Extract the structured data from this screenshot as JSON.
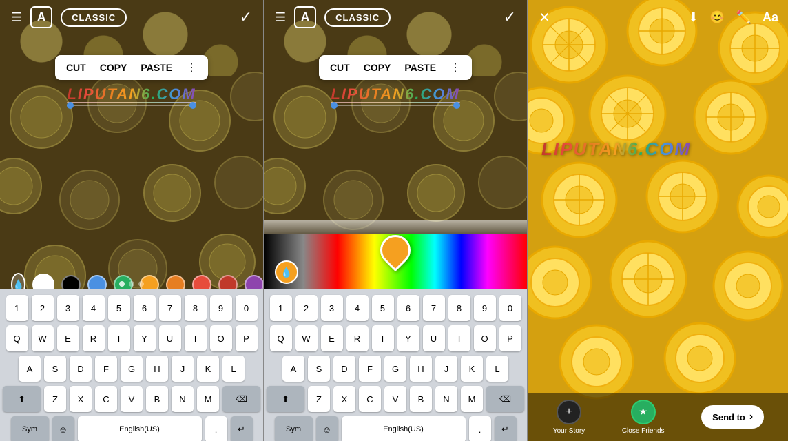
{
  "panels": [
    {
      "id": "panel1",
      "topbar": {
        "hamburger": "☰",
        "textFormat": "A",
        "mode": "CLASSIC",
        "checkmark": "✓"
      },
      "editMenu": {
        "cut": "CUT",
        "copy": "COPY",
        "paste": "PASTE",
        "dots": "⋮"
      },
      "watermark": "LIPUTAN6.COM",
      "colors": [
        "#ffffff",
        "#000000",
        "#4a90e2",
        "#27ae60",
        "#f5a020",
        "#e67e22",
        "#e74c3c",
        "#c0392b",
        "#8e44ad"
      ],
      "keyboard": {
        "row0": [
          "1",
          "2",
          "3",
          "4",
          "5",
          "6",
          "7",
          "8",
          "9",
          "0"
        ],
        "row1": [
          "Q",
          "W",
          "E",
          "R",
          "T",
          "Y",
          "U",
          "I",
          "O",
          "P"
        ],
        "row2": [
          "A",
          "S",
          "D",
          "F",
          "G",
          "H",
          "J",
          "K",
          "L"
        ],
        "row3": [
          "Z",
          "X",
          "C",
          "V",
          "B",
          "N",
          "M"
        ],
        "sym": "Sym",
        "emoji": "☺",
        "lang": "English(US)",
        "period": ".",
        "enter": "↵",
        "shift": "⬆",
        "delete": "⌫"
      }
    },
    {
      "id": "panel2",
      "topbar": {
        "hamburger": "☰",
        "textFormat": "A",
        "mode": "CLASSIC",
        "checkmark": "✓"
      },
      "editMenu": {
        "cut": "CUT",
        "copy": "COPY",
        "paste": "PASTE",
        "dots": "⋮"
      },
      "watermark": "LIPUTAN6.COM",
      "keyboard": {
        "row0": [
          "1",
          "2",
          "3",
          "4",
          "5",
          "6",
          "7",
          "8",
          "9",
          "0"
        ],
        "row1": [
          "Q",
          "W",
          "E",
          "R",
          "T",
          "Y",
          "U",
          "I",
          "O",
          "P"
        ],
        "row2": [
          "A",
          "S",
          "D",
          "F",
          "G",
          "H",
          "J",
          "K",
          "L"
        ],
        "row3": [
          "Z",
          "X",
          "C",
          "V",
          "B",
          "N",
          "M"
        ],
        "sym": "Sym",
        "emoji": "☺",
        "lang": "English(US)",
        "period": ".",
        "enter": "↵",
        "shift": "⬆",
        "delete": "⌫"
      }
    },
    {
      "id": "panel3",
      "topbar": {
        "close": "✕",
        "download": "⬇",
        "sticker": "✏",
        "draw": "✏",
        "textFormat": "Aa"
      },
      "watermark": "LIPUTAN6.COM",
      "bottomBar": {
        "yourStory": "Your Story",
        "closeFriends": "Close Friends",
        "sendTo": "Send to",
        "chevron": "›"
      },
      "accent": "#8e44ad"
    }
  ]
}
